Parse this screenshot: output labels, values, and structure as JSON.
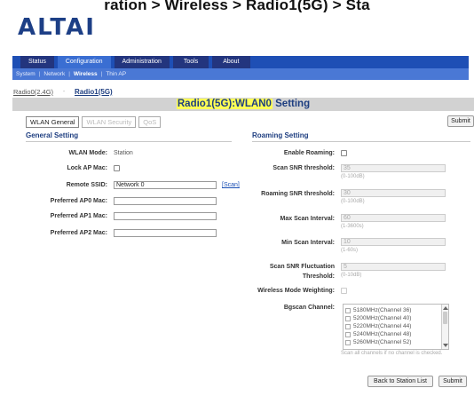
{
  "breadcrumb": "ration > Wireless > Radio1(5G) > Sta",
  "logo": "ALTAI",
  "nav": {
    "tabs": [
      "Status",
      "Configuration",
      "Administration",
      "Tools",
      "About"
    ],
    "sub": [
      "System",
      "Network",
      "Wireless",
      "Thin AP"
    ]
  },
  "radios": [
    "Radio0(2.4G)",
    "Radio1(5G)"
  ],
  "title": {
    "highlight": "Radio1(5G):WLAN0",
    "rest": " Setting"
  },
  "tabs": [
    "WLAN General",
    "WLAN Security",
    "QoS"
  ],
  "buttons": {
    "submit_top": "Submit",
    "back": "Back to Station List",
    "submit_bottom": "Submit"
  },
  "general": {
    "heading": "General Setting",
    "wlan_mode_label": "WLAN Mode:",
    "wlan_mode_value": "Station",
    "lock_ap_label": "Lock AP Mac:",
    "remote_ssid_label": "Remote SSID:",
    "remote_ssid_value": "Network 0",
    "scan_link": "[Scan]",
    "ap0_label": "Preferred AP0 Mac:",
    "ap1_label": "Preferred AP1 Mac:",
    "ap2_label": "Preferred AP2 Mac:"
  },
  "roaming": {
    "heading": "Roaming Setting",
    "enable_label": "Enable Roaming:",
    "scan_snr_label": "Scan SNR threshold:",
    "scan_snr_value": "35",
    "scan_snr_hint": "(0-100dB)",
    "roam_snr_label": "Roaming SNR threshold:",
    "roam_snr_value": "30",
    "roam_snr_hint": "(0-100dB)",
    "max_scan_label": "Max Scan Interval:",
    "max_scan_value": "60",
    "max_scan_hint": "(1-3600s)",
    "min_scan_label": "Min Scan Interval:",
    "min_scan_value": "10",
    "min_scan_hint": "(1-60s)",
    "fluct_label_1": "Scan SNR Fluctuation",
    "fluct_label_2": "Threshold:",
    "fluct_value": "5",
    "fluct_hint": "(0-10dB)",
    "wmw_label": "Wireless Mode Weighting:",
    "bgscan_label": "Bgscan Channel:",
    "channels": [
      "5180MHz(Channel 36)",
      "5200MHz(Channel 40)",
      "5220MHz(Channel 44)",
      "5240MHz(Channel 48)",
      "5260MHz(Channel 52)"
    ],
    "bgscan_hint": "Scan all channels if no channel is checked."
  }
}
